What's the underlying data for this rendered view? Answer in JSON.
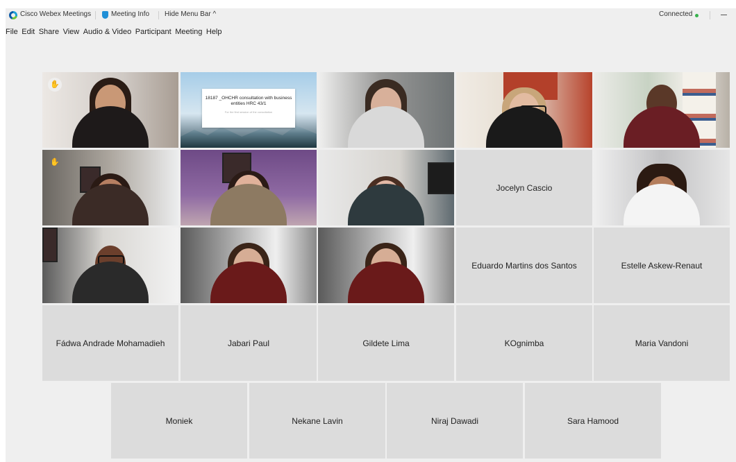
{
  "app": {
    "title": "Cisco Webex Meetings",
    "meeting_info": "Meeting Info",
    "hide_menu_bar": "Hide Menu Bar ^",
    "status": "Connected",
    "minimize_icon": "minimize-icon"
  },
  "menu": [
    "File",
    "Edit",
    "Share",
    "View",
    "Audio & Video",
    "Participant",
    "Meeting",
    "Help"
  ],
  "shared_content": {
    "title": "18187 _OHCHR consultation with business entities HRC 43/1",
    "subtitle": "For the first session of the consultation"
  },
  "participants_no_video": [
    "Jocelyn Cascio",
    "Eduardo Martins dos Santos",
    "Estelle Askew-Renaut",
    "Fádwa Andrade Mohamadieh",
    "Jabari Paul",
    "Gildete Lima",
    "KOgnimba",
    "Maria Vandoni",
    "Moniek",
    "Nekane Lavin",
    "Niraj Dawadi",
    "Sara Hamood"
  ],
  "icons": {
    "raise_hand": "raise-hand-icon",
    "shield": "shield-icon",
    "logo": "webex-logo-icon"
  },
  "colors": {
    "connected": "#37b24d",
    "tile_bg": "#dcdcdc",
    "window_bg": "#efefef"
  }
}
